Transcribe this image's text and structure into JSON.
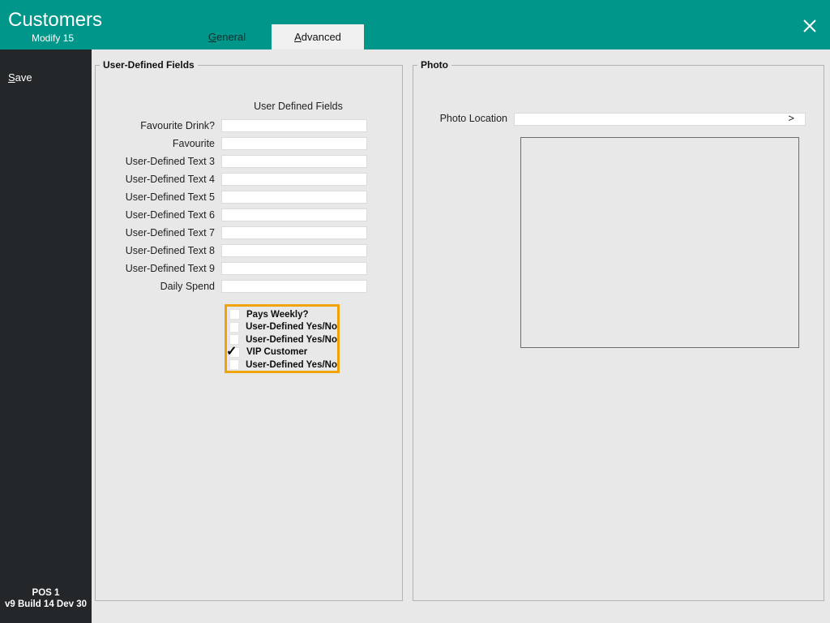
{
  "window": {
    "title": "Customers",
    "subtitle": "Modify 15"
  },
  "tabs": [
    {
      "label": "General",
      "selected": false
    },
    {
      "label": "Advanced",
      "selected": true
    }
  ],
  "sidebar": {
    "save_label": "Save",
    "terminal": "POS 1",
    "version": "v9 Build 14 Dev 30"
  },
  "user_defined_fields": {
    "group_title": "User-Defined Fields",
    "column_header": "User Defined Fields",
    "text_fields": [
      {
        "label": "Favourite Drink?",
        "value": ""
      },
      {
        "label": "Favourite",
        "value": ""
      },
      {
        "label": "User-Defined Text 3",
        "value": ""
      },
      {
        "label": "User-Defined Text 4",
        "value": ""
      },
      {
        "label": "User-Defined Text 5",
        "value": ""
      },
      {
        "label": "User-Defined Text 6",
        "value": ""
      },
      {
        "label": "User-Defined Text 7",
        "value": ""
      },
      {
        "label": "User-Defined Text 8",
        "value": ""
      },
      {
        "label": "User-Defined Text 9",
        "value": ""
      },
      {
        "label": "Daily Spend",
        "value": ""
      }
    ],
    "checkboxes": [
      {
        "label": "Pays Weekly?",
        "checked": false
      },
      {
        "label": "User-Defined Yes/No",
        "checked": false
      },
      {
        "label": "User-Defined Yes/No",
        "checked": false
      },
      {
        "label": "VIP Customer",
        "checked": true
      },
      {
        "label": "User-Defined Yes/No",
        "checked": false
      }
    ],
    "check_glyph": "✓"
  },
  "photo": {
    "group_title": "Photo",
    "location_label": "Photo Location",
    "location_value": "",
    "browse_glyph": ">"
  },
  "colors": {
    "header_teal": "#00968A",
    "sidebar_dark": "#24272A",
    "background": "#E8E8E8",
    "active_tab_bg": "#F1F1F1",
    "highlight_orange": "#F0A30A"
  }
}
